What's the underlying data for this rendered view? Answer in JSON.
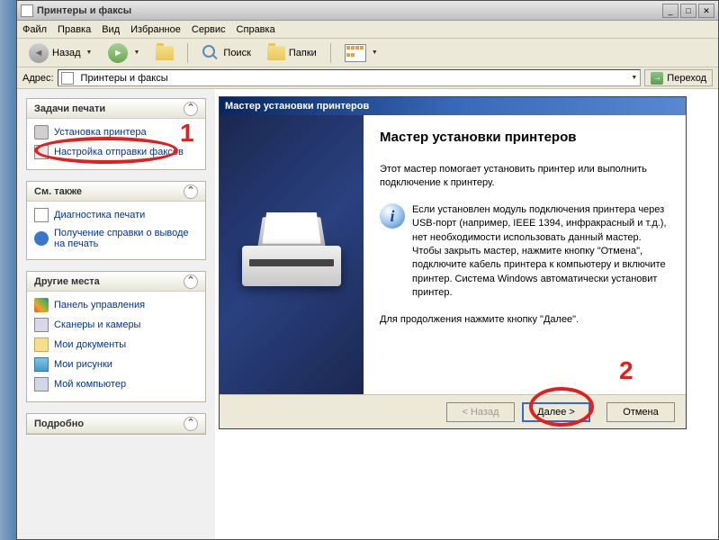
{
  "window": {
    "title": "Принтеры и факсы",
    "menu": [
      "Файл",
      "Правка",
      "Вид",
      "Избранное",
      "Сервис",
      "Справка"
    ],
    "toolbar": {
      "back": "Назад",
      "search": "Поиск",
      "folders": "Папки"
    },
    "addressbar": {
      "label": "Адрес:",
      "value": "Принтеры и факсы",
      "go": "Переход"
    }
  },
  "sidebar": {
    "panels": [
      {
        "title": "Задачи печати",
        "items": [
          {
            "label": "Установка принтера",
            "icon": "icon-printer"
          },
          {
            "label": "Настройка отправки факсов",
            "icon": "icon-fax"
          }
        ]
      },
      {
        "title": "См. также",
        "items": [
          {
            "label": "Диагностика печати",
            "icon": "icon-diag"
          },
          {
            "label": "Получение справки о выводе на печать",
            "icon": "icon-help"
          }
        ]
      },
      {
        "title": "Другие места",
        "items": [
          {
            "label": "Панель управления",
            "icon": "icon-cp"
          },
          {
            "label": "Сканеры и камеры",
            "icon": "icon-scan"
          },
          {
            "label": "Мои документы",
            "icon": "icon-doc"
          },
          {
            "label": "Мои рисунки",
            "icon": "icon-pic"
          },
          {
            "label": "Мой компьютер",
            "icon": "icon-mypc"
          }
        ]
      },
      {
        "title": "Подробно",
        "items": []
      }
    ]
  },
  "wizard": {
    "title": "Мастер установки принтеров",
    "heading": "Мастер установки принтеров",
    "intro": "Этот мастер помогает установить принтер или выполнить подключение к принтеру.",
    "info": "Если установлен модуль подключения принтера через USB-порт (например, IEEE 1394, инфракрасный и т.д.), нет необходимости использовать данный мастер. Чтобы закрыть мастер, нажмите кнопку \"Отмена\", подключите кабель принтера к компьютеру и включите принтер. Система Windows автоматически установит принтер.",
    "continue": "Для продолжения нажмите кнопку \"Далее\".",
    "buttons": {
      "back": "< Назад",
      "next": "Далее >",
      "cancel": "Отмена"
    }
  },
  "annotations": {
    "one": "1",
    "two": "2"
  }
}
